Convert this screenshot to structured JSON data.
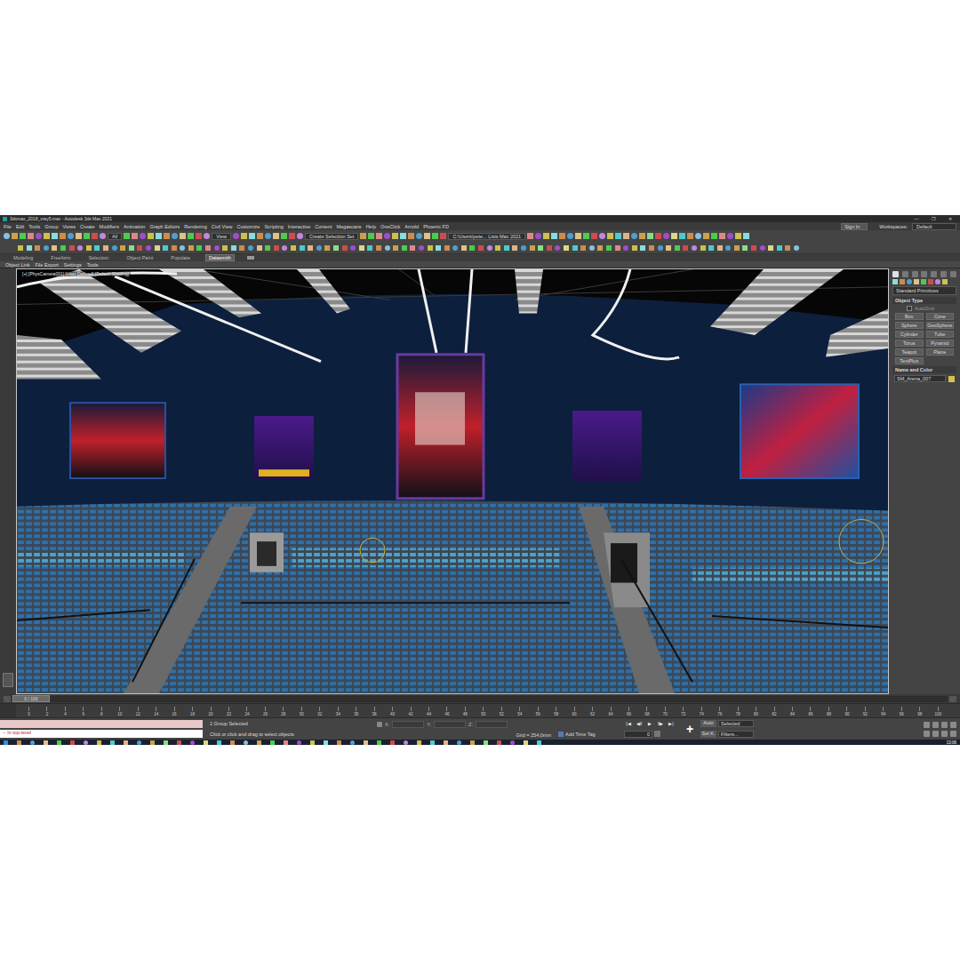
{
  "window": {
    "title": "3dsmax_2018_vray5.max - Autodesk 3ds Max 2021",
    "controls": [
      "—",
      "❐",
      "✕"
    ]
  },
  "menu": [
    "File",
    "Edit",
    "Tools",
    "Group",
    "Views",
    "Create",
    "Modifiers",
    "Animation",
    "Graph Editors",
    "Rendering",
    "Civil View",
    "Customize",
    "Scripting",
    "Interactive",
    "Content",
    "Megascans",
    "Help",
    "OneClick",
    "Arnold",
    "Phoenix FD"
  ],
  "account": {
    "sign_in": "Sign In",
    "workspaces_label": "Workspaces:",
    "workspace": "Default"
  },
  "toolbar": {
    "selection_filter": "All",
    "reference_coord": "View",
    "selection_set": "Create Selection Set",
    "project_path": "C:\\Users\\pete... Lists Max 2021"
  },
  "ribbon": {
    "tabs": [
      {
        "label": "Modeling",
        "selected": false
      },
      {
        "label": "Freeform",
        "selected": false
      },
      {
        "label": "Selection",
        "selected": false
      },
      {
        "label": "Object Paint",
        "selected": false
      },
      {
        "label": "Populate",
        "selected": false
      },
      {
        "label": "Datasmith",
        "selected": true
      }
    ],
    "tools": [
      "Object Link",
      "File Export",
      "Settings",
      "Tools"
    ]
  },
  "viewport": {
    "label": "[+] [PhysCamera001] [User Defined] [Default Shading]"
  },
  "command_panel": {
    "category": "Standard Primitives",
    "object_type": {
      "title": "Object Type",
      "autogrid": {
        "label": "AutoGrid",
        "checked": false
      },
      "buttons": [
        "Box",
        "Cone",
        "Sphere",
        "GeoSphere",
        "Cylinder",
        "Tube",
        "Torus",
        "Pyramid",
        "Teapot",
        "Plane",
        "TextPlus"
      ]
    },
    "name_and_color": {
      "title": "Name and Color",
      "object_name": "SM_Arena_007",
      "color": "#d8c050"
    }
  },
  "timeline": {
    "frame_counter": "0 / 100",
    "level": 0,
    "ticks": [
      "0",
      "2",
      "4",
      "6",
      "8",
      "10",
      "12",
      "14",
      "16",
      "18",
      "20",
      "22",
      "24",
      "26",
      "28",
      "30",
      "32",
      "34",
      "36",
      "38",
      "40",
      "42",
      "44",
      "46",
      "48",
      "50",
      "52",
      "54",
      "56",
      "58",
      "60",
      "62",
      "64",
      "66",
      "68",
      "70",
      "72",
      "74",
      "76",
      "78",
      "80",
      "82",
      "84",
      "86",
      "88",
      "90",
      "92",
      "94",
      "96",
      "98",
      "100"
    ]
  },
  "status_bar": {
    "listener": "-- In top-level",
    "selection": "1 Group Selected",
    "prompt": "Click or click and drag to select objects",
    "coords": [
      {
        "axis": "X:",
        "value": ""
      },
      {
        "axis": "Y:",
        "value": ""
      },
      {
        "axis": "Z:",
        "value": ""
      }
    ],
    "grid": "Grid = 254,0mm",
    "time_tag": "Add Time Tag",
    "playback": [
      "|◀",
      "◀‖",
      "▶",
      "‖▶",
      "▶|"
    ],
    "frame": "0",
    "key_mode": "Auto",
    "key_filter": "Selected",
    "set_key": "Set K.",
    "filters": "Filters...",
    "clock": "13:06"
  }
}
